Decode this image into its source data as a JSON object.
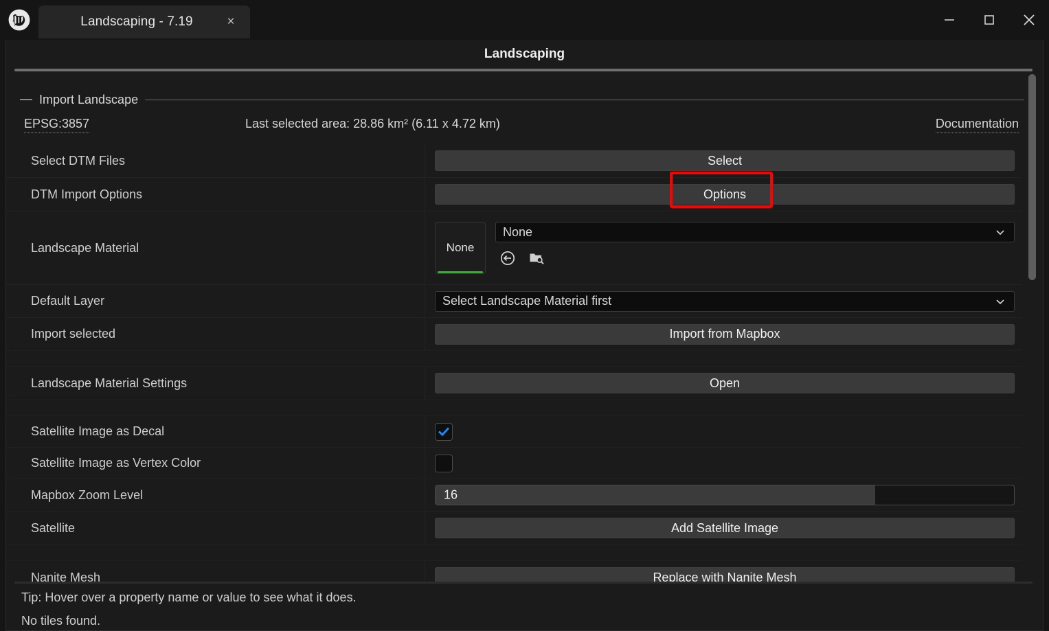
{
  "titlebar": {
    "logo_icon": "unreal-engine-logo",
    "tab_title": "Landscaping - 7.19",
    "tab_close_icon": "×",
    "minimize_icon": "minimize-icon",
    "maximize_icon": "maximize-icon",
    "close_icon": "close-icon"
  },
  "panel": {
    "title": "Landscaping"
  },
  "section": {
    "label": "Import Landscape"
  },
  "info": {
    "epsg": "EPSG:3857",
    "area": "Last selected area: 28.86 km² (6.11 x 4.72 km)",
    "documentation": "Documentation"
  },
  "rows": {
    "select_dtm_files": {
      "label": "Select DTM Files",
      "button": "Select"
    },
    "dtm_import_options": {
      "label": "DTM Import Options",
      "button": "Options"
    },
    "landscape_material": {
      "label": "Landscape Material",
      "thumb": "None",
      "combo_value": "None",
      "use_selected_icon": "use-selected-asset-icon",
      "browse_icon": "browse-to-asset-icon"
    },
    "default_layer": {
      "label": "Default Layer",
      "combo_value": "Select Landscape Material first"
    },
    "import_selected": {
      "label": "Import selected",
      "button": "Import from Mapbox"
    },
    "landscape_material_settings": {
      "label": "Landscape Material Settings",
      "button": "Open"
    },
    "satellite_decal": {
      "label": "Satellite Image as Decal",
      "checked": true
    },
    "satellite_vertex_color": {
      "label": "Satellite Image as Vertex Color",
      "checked": false
    },
    "mapbox_zoom_level": {
      "label": "Mapbox Zoom Level",
      "value": "16",
      "fill_percent": 76
    },
    "satellite": {
      "label": "Satellite",
      "button": "Add Satellite Image"
    },
    "nanite_mesh": {
      "label": "Nanite Mesh",
      "button": "Replace with Nanite Mesh"
    }
  },
  "footer": {
    "tip": "Tip: Hover over a property name or value to see what it does.",
    "status": "No tiles found."
  },
  "colors": {
    "highlight": "#fe0000",
    "checkbox_check": "#1a8cff",
    "thumb_accent": "#16c60c",
    "window_bg": "#1b1b1b",
    "button_bg": "#3a3a3a"
  }
}
